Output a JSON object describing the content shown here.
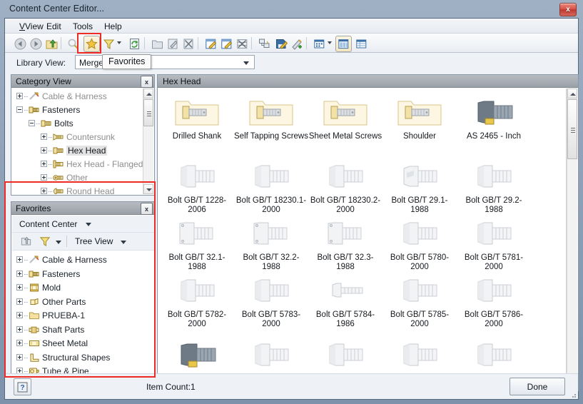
{
  "window": {
    "title": "Content Center Editor...",
    "close_label": "x"
  },
  "menu": {
    "items": [
      {
        "label": "View",
        "accel": "V"
      },
      {
        "label": "Edit",
        "accel": "E"
      },
      {
        "label": "Tools",
        "accel": "T"
      },
      {
        "label": "Help",
        "accel": "H"
      }
    ]
  },
  "toolbar": {
    "buttons": [
      {
        "name": "back-icon",
        "tip": "Back"
      },
      {
        "name": "forward-icon",
        "tip": "Forward"
      },
      {
        "name": "up-folder-icon",
        "tip": "Up One Level"
      },
      {
        "name": "search-icon",
        "tip": "Search"
      },
      {
        "name": "favorites-star-icon",
        "tip": "Favorites"
      },
      {
        "name": "filter-funnel-icon",
        "tip": "Filter"
      },
      {
        "name": "refresh-icon",
        "tip": "Refresh"
      },
      {
        "name": "new-folder-icon",
        "tip": "New Category"
      },
      {
        "name": "edit-document-icon",
        "tip": "Edit"
      },
      {
        "name": "delete-document-icon",
        "tip": "Delete"
      },
      {
        "name": "edit-family-icon",
        "tip": "Edit Family"
      },
      {
        "name": "edit-family-table-icon",
        "tip": "Edit Family Table"
      },
      {
        "name": "family-table-delete-icon",
        "tip": "Delete Family"
      },
      {
        "name": "copy-family-icon",
        "tip": "Copy Family"
      },
      {
        "name": "save-pencil-icon",
        "tip": "Save"
      },
      {
        "name": "publish-icon",
        "tip": "Publish"
      },
      {
        "name": "view-options-icon",
        "tip": "View Options"
      },
      {
        "name": "list-view-icon",
        "tip": "List View"
      },
      {
        "name": "detail-view-icon",
        "tip": "Detail View"
      }
    ]
  },
  "library": {
    "label": "Library View:",
    "value": "Merged",
    "tooltip": "Favorites"
  },
  "category_view": {
    "title": "Category View",
    "close_label": "x",
    "nodes": [
      {
        "label": "Cable & Harness",
        "depth": 0,
        "expander": "plus",
        "icon": "cable-harness-icon",
        "dim": true,
        "selected": false
      },
      {
        "label": "Fasteners",
        "depth": 0,
        "expander": "minus",
        "icon": "fasteners-icon",
        "dim": false,
        "selected": false
      },
      {
        "label": "Bolts",
        "depth": 1,
        "expander": "minus",
        "icon": "bolt-icon",
        "dim": false,
        "selected": false
      },
      {
        "label": "Countersunk",
        "depth": 2,
        "expander": "plus",
        "icon": "countersunk-icon",
        "dim": true,
        "selected": false
      },
      {
        "label": "Hex Head",
        "depth": 2,
        "expander": "plus",
        "icon": "hexhead-icon",
        "dim": false,
        "selected": true
      },
      {
        "label": "Hex Head - Flanged",
        "depth": 2,
        "expander": "plus",
        "icon": "hexflange-icon",
        "dim": true,
        "selected": false
      },
      {
        "label": "Other",
        "depth": 2,
        "expander": "plus",
        "icon": "other-bolt-icon",
        "dim": true,
        "selected": false
      },
      {
        "label": "Round Head",
        "depth": 2,
        "expander": "plus",
        "icon": "roundhead-icon",
        "dim": true,
        "selected": false
      }
    ]
  },
  "favorites": {
    "title": "Favorites",
    "close_label": "x",
    "source_label": "Content Center",
    "view_mode_label": "Tree View",
    "nodes": [
      {
        "label": "Cable & Harness",
        "icon": "cable-harness-icon"
      },
      {
        "label": "Fasteners",
        "icon": "fasteners-icon"
      },
      {
        "label": "Mold",
        "icon": "mold-icon"
      },
      {
        "label": "Other Parts",
        "icon": "other-parts-icon"
      },
      {
        "label": "PRUEBA-1",
        "icon": "folder-icon"
      },
      {
        "label": "Shaft Parts",
        "icon": "shaft-parts-icon"
      },
      {
        "label": "Sheet Metal",
        "icon": "sheet-metal-icon"
      },
      {
        "label": "Structural Shapes",
        "icon": "structural-shapes-icon"
      },
      {
        "label": "Tube & Pipe",
        "icon": "tube-pipe-icon"
      }
    ]
  },
  "items_panel": {
    "title": "Hex Head",
    "rows": [
      [
        {
          "label": "Drilled Shank",
          "kind": "folder"
        },
        {
          "label": "Self Tapping Screws",
          "kind": "folder"
        },
        {
          "label": "Sheet Metal Screws",
          "kind": "folder"
        },
        {
          "label": "Shoulder",
          "kind": "folder"
        },
        {
          "label": "AS 2465 - Inch",
          "kind": "part-dark"
        }
      ],
      [
        {
          "label": "Bolt GB/T 1228-2006",
          "kind": "part"
        },
        {
          "label": "Bolt GB/T 18230.1-2000",
          "kind": "part"
        },
        {
          "label": "Bolt GB/T 18230.2-2000",
          "kind": "part"
        },
        {
          "label": "Bolt GB/T 29.1-1988",
          "kind": "part-slot"
        },
        {
          "label": "Bolt GB/T 29.2-1988",
          "kind": "part"
        }
      ],
      [
        {
          "label": "Bolt GB/T 32.1-1988",
          "kind": "part-flange"
        },
        {
          "label": "Bolt GB/T 32.2-1988",
          "kind": "part-flange"
        },
        {
          "label": "Bolt GB/T 32.3-1988",
          "kind": "part-flange"
        },
        {
          "label": "Bolt GB/T 5780-2000",
          "kind": "part"
        },
        {
          "label": "Bolt GB/T 5781-2000",
          "kind": "part"
        }
      ],
      [
        {
          "label": "Bolt GB/T 5782-2000",
          "kind": "part"
        },
        {
          "label": "Bolt GB/T 5783-2000",
          "kind": "part"
        },
        {
          "label": "Bolt GB/T 5784-1986",
          "kind": "part-thin"
        },
        {
          "label": "Bolt GB/T 5785-2000",
          "kind": "part"
        },
        {
          "label": "Bolt GB/T 5786-2000",
          "kind": "part"
        }
      ],
      [
        {
          "label": "",
          "kind": "part-dark"
        },
        {
          "label": "",
          "kind": "part"
        },
        {
          "label": "",
          "kind": "part"
        },
        {
          "label": "",
          "kind": "part"
        },
        {
          "label": "",
          "kind": "part"
        }
      ]
    ]
  },
  "status": {
    "item_count": "Item Count:1",
    "done_label": "Done",
    "help_label": "?"
  },
  "colors": {
    "accent_red": "#ee2a24",
    "title_gradient_top": "#9fb0c4",
    "panel_caption": "#9aa0a8",
    "star_gold": "#f2c53d"
  }
}
